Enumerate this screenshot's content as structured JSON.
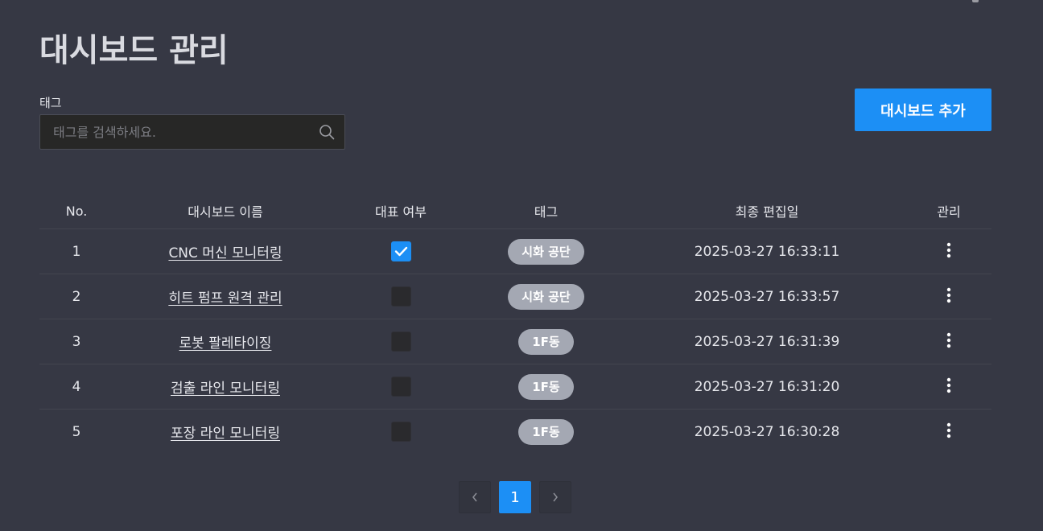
{
  "page": {
    "title": "대시보드 관리"
  },
  "filter": {
    "label": "태그",
    "search_placeholder": "태그를 검색하세요."
  },
  "actions": {
    "add_label": "대시보드 추가"
  },
  "table": {
    "columns": [
      "No.",
      "대시보드 이름",
      "대표 여부",
      "태그",
      "최종 편집일",
      "관리"
    ],
    "rows": [
      {
        "no": "1",
        "name": "CNC 머신 모니터링",
        "representative": true,
        "tag": "시화 공단",
        "edited": "2025-03-27 16:33:11"
      },
      {
        "no": "2",
        "name": "히트 펌프 원격 관리",
        "representative": false,
        "tag": "시화 공단",
        "edited": "2025-03-27 16:33:57"
      },
      {
        "no": "3",
        "name": "로봇 팔레타이징",
        "representative": false,
        "tag": "1F동",
        "edited": "2025-03-27 16:31:39"
      },
      {
        "no": "4",
        "name": "검출 라인 모니터링",
        "representative": false,
        "tag": "1F동",
        "edited": "2025-03-27 16:31:20"
      },
      {
        "no": "5",
        "name": "포장 라인 모니터링",
        "representative": false,
        "tag": "1F동",
        "edited": "2025-03-27 16:30:28"
      }
    ]
  },
  "pagination": {
    "current_page": "1"
  },
  "icons": {
    "search": "search-icon",
    "more": "more-vertical-icon",
    "check": "check-icon",
    "prev": "chevron-left-icon",
    "next": "chevron-right-icon"
  },
  "colors": {
    "background": "#363844",
    "accent": "#1c8ff5",
    "tag_badge": "#a4a8b3",
    "search_bg": "#272726"
  }
}
